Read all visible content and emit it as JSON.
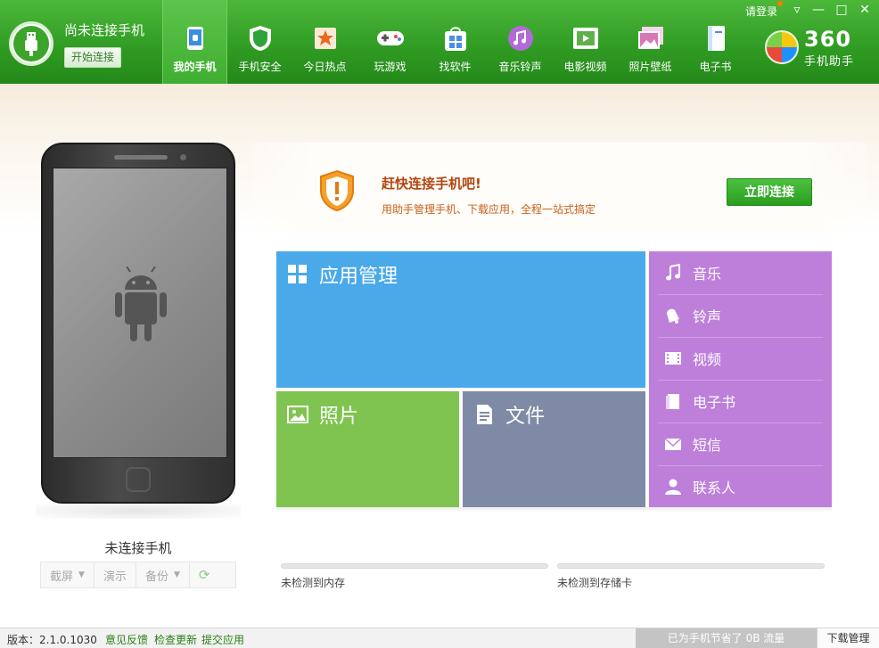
{
  "header": {
    "phone_status": "尚未连接手机",
    "connect_button": "开始连接",
    "login": "请登录",
    "nav": [
      {
        "label": "我的手机",
        "icon": "phone-icon",
        "color": "#3c8fdc",
        "active": true
      },
      {
        "label": "手机安全",
        "icon": "shield-icon",
        "color": "#2fa33a"
      },
      {
        "label": "今日热点",
        "icon": "star-icon",
        "color": "#e86a1c"
      },
      {
        "label": "玩游戏",
        "icon": "gamepad-icon",
        "color": "#eeeeee"
      },
      {
        "label": "找软件",
        "icon": "apps-bag-icon",
        "color": "#4a8fe0"
      },
      {
        "label": "音乐铃声",
        "icon": "music-icon",
        "color": "#b26ad8"
      },
      {
        "label": "电影视频",
        "icon": "film-icon",
        "color": "#5fb04a"
      },
      {
        "label": "照片壁纸",
        "icon": "photo-icon",
        "color": "#d977b7"
      },
      {
        "label": "电子书",
        "icon": "book-icon",
        "color": "#4a8fe0"
      }
    ],
    "brand_number": "360",
    "brand_name": "手机助手"
  },
  "phone_panel": {
    "caption": "未连接手机",
    "tools": [
      "截屏",
      "演示",
      "备份"
    ]
  },
  "banner": {
    "title": "赶快连接手机吧!",
    "subtitle": "用助手管理手机、下载应用，全程一站式搞定",
    "button": "立即连接"
  },
  "tiles": {
    "apps": "应用管理",
    "photos": "照片",
    "files": "文件"
  },
  "media": [
    {
      "label": "音乐",
      "icon": "music-note-icon"
    },
    {
      "label": "铃声",
      "icon": "bell-icon"
    },
    {
      "label": "视频",
      "icon": "film-strip-icon"
    },
    {
      "label": "电子书",
      "icon": "ebook-icon"
    },
    {
      "label": "短信",
      "icon": "envelope-icon"
    },
    {
      "label": "联系人",
      "icon": "contact-icon"
    }
  ],
  "storage": {
    "memory": "未检测到内存",
    "sdcard": "未检测到存储卡"
  },
  "footer": {
    "version": "版本：2.1.0.1030",
    "feedback": "意见反馈",
    "check_update": "检查更新",
    "submit_app": "提交应用",
    "saved": "已为手机节省了 0B 流量",
    "download_manager": "下载管理"
  }
}
